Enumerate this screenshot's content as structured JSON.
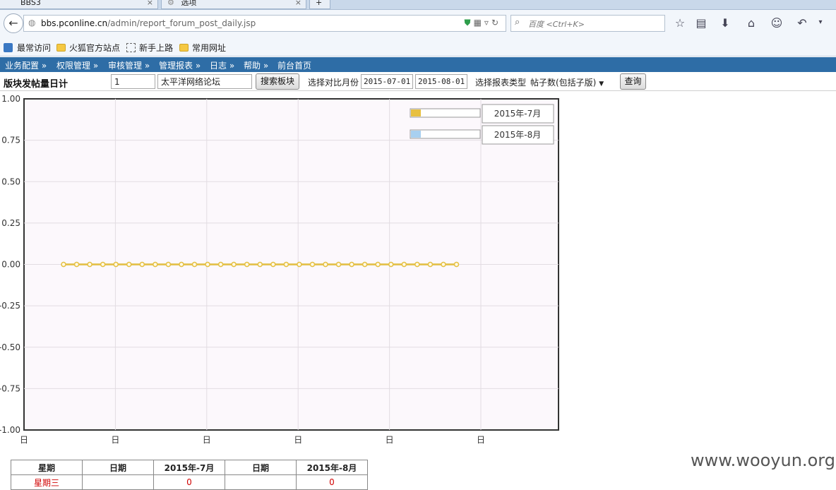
{
  "browser": {
    "tabs": [
      {
        "title": "BBS3"
      },
      {
        "title": "选项"
      }
    ],
    "url_host": "bbs.pconline.cn",
    "url_path": "/admin/report_forum_post_daily.jsp",
    "search_placeholder": "百度 <Ctrl+K>",
    "bookmarks": [
      "最常访问",
      "火狐官方站点",
      "新手上路",
      "常用网址"
    ]
  },
  "menu": [
    "业务配置 »",
    "权限管理 »",
    "审核管理 »",
    "管理报表 »",
    "日志 »",
    "帮助 »",
    "前台首页"
  ],
  "toolbar": {
    "title": "版块发帖量日计",
    "forum_id": "1",
    "forum_name": "太平洋网络论坛",
    "search_button": "搜索板块",
    "compare_label": "选择对比月份",
    "month1": "2015-07-01",
    "month2": "2015-08-01",
    "type_label": "选择报表类型",
    "type_value": "帖子数(包括子版)",
    "query_button": "查询"
  },
  "chart_data": {
    "type": "line",
    "ylim": [
      -1,
      1
    ],
    "yticks": [
      "1.00",
      "0.75",
      "0.50",
      "0.25",
      "0.00",
      "-0.25",
      "-0.50",
      "-0.75",
      "-1.00"
    ],
    "xticks": [
      "日",
      "日",
      "日",
      "日",
      "日",
      "日"
    ],
    "legend_position": "top-right",
    "grid": true,
    "colors": {
      "s1": "#e8c040",
      "s2": "#a8d0f0",
      "plot_bg": "#fcf8fc"
    },
    "series": [
      {
        "name": "2015年-7月",
        "values": [
          0,
          0,
          0,
          0,
          0,
          0,
          0,
          0,
          0,
          0,
          0,
          0,
          0,
          0,
          0,
          0,
          0,
          0,
          0,
          0,
          0,
          0,
          0,
          0,
          0,
          0,
          0,
          0,
          0,
          0,
          0
        ]
      },
      {
        "name": "2015年-8月",
        "values": [
          0,
          0,
          0,
          0,
          0,
          0,
          0,
          0,
          0,
          0,
          0,
          0,
          0,
          0,
          0,
          0,
          0,
          0,
          0,
          0,
          0,
          0,
          0,
          0,
          0,
          0,
          0,
          0,
          0,
          0,
          0
        ]
      }
    ]
  },
  "table": {
    "headers": [
      "星期",
      "日期",
      "2015年-7月",
      "日期",
      "2015年-8月"
    ],
    "first_row": [
      "星期三",
      "",
      "0",
      "",
      "0"
    ]
  },
  "watermark": "www.wooyun.org"
}
